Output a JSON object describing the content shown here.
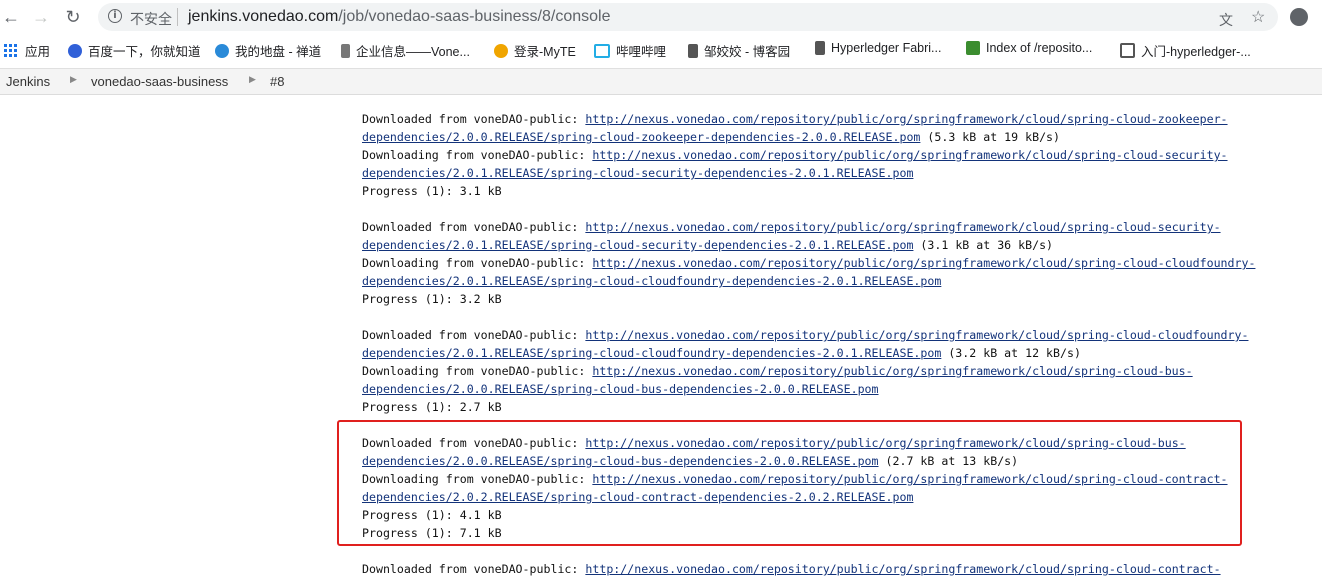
{
  "browser": {
    "security_label": "不安全",
    "url_host": "jenkins.vonedao.com",
    "url_path": "/job/vonedao-saas-business/8/console",
    "bookmarks": [
      {
        "label": "应用",
        "color": "#1a73e8"
      },
      {
        "label": "百度一下，你就知道",
        "color": "#3060d8"
      },
      {
        "label": "我的地盘 - 禅道",
        "color": "#2a8ad8"
      },
      {
        "label": "企业信息——Vone...",
        "color": "#555555"
      },
      {
        "label": "登录-MyTE",
        "color": "#f0a500"
      },
      {
        "label": "哔哩哔哩",
        "color": "#23ade5"
      },
      {
        "label": "邹姣姣 - 博客园",
        "color": "#555555"
      },
      {
        "label": "Hyperledger Fabri...",
        "color": "#555555"
      },
      {
        "label": "Index of /reposito...",
        "color": "#3b8d2f"
      },
      {
        "label": "入门-hyperledger-...",
        "color": "#555555"
      }
    ]
  },
  "jenkins": {
    "breadcrumbs": [
      "Jenkins",
      "vonedao-saas-business",
      "#8"
    ]
  },
  "console": {
    "lines": [
      {
        "prefix": "Downloaded from voneDAO-public: ",
        "link": "http://nexus.vonedao.com/repository/public/org/springframework/cloud/spring-cloud-zookeeper-",
        "suffix": ""
      },
      {
        "prefix": "",
        "link": "dependencies/2.0.0.RELEASE/spring-cloud-zookeeper-dependencies-2.0.0.RELEASE.pom",
        "suffix": " (5.3 kB at 19 kB/s)"
      },
      {
        "prefix": "Downloading from voneDAO-public: ",
        "link": "http://nexus.vonedao.com/repository/public/org/springframework/cloud/spring-cloud-security-",
        "suffix": ""
      },
      {
        "prefix": "",
        "link": "dependencies/2.0.1.RELEASE/spring-cloud-security-dependencies-2.0.1.RELEASE.pom",
        "suffix": ""
      },
      {
        "prefix": "Progress (1): 3.1 kB",
        "link": "",
        "suffix": ""
      },
      {
        "prefix": "",
        "link": "",
        "suffix": ""
      },
      {
        "prefix": "Downloaded from voneDAO-public: ",
        "link": "http://nexus.vonedao.com/repository/public/org/springframework/cloud/spring-cloud-security-",
        "suffix": ""
      },
      {
        "prefix": "",
        "link": "dependencies/2.0.1.RELEASE/spring-cloud-security-dependencies-2.0.1.RELEASE.pom",
        "suffix": " (3.1 kB at 36 kB/s)"
      },
      {
        "prefix": "Downloading from voneDAO-public: ",
        "link": "http://nexus.vonedao.com/repository/public/org/springframework/cloud/spring-cloud-cloudfoundry-",
        "suffix": ""
      },
      {
        "prefix": "",
        "link": "dependencies/2.0.1.RELEASE/spring-cloud-cloudfoundry-dependencies-2.0.1.RELEASE.pom",
        "suffix": ""
      },
      {
        "prefix": "Progress (1): 3.2 kB",
        "link": "",
        "suffix": ""
      },
      {
        "prefix": "",
        "link": "",
        "suffix": ""
      },
      {
        "prefix": "Downloaded from voneDAO-public: ",
        "link": "http://nexus.vonedao.com/repository/public/org/springframework/cloud/spring-cloud-cloudfoundry-",
        "suffix": ""
      },
      {
        "prefix": "",
        "link": "dependencies/2.0.1.RELEASE/spring-cloud-cloudfoundry-dependencies-2.0.1.RELEASE.pom",
        "suffix": " (3.2 kB at 12 kB/s)"
      },
      {
        "prefix": "Downloading from voneDAO-public: ",
        "link": "http://nexus.vonedao.com/repository/public/org/springframework/cloud/spring-cloud-bus-",
        "suffix": ""
      },
      {
        "prefix": "",
        "link": "dependencies/2.0.0.RELEASE/spring-cloud-bus-dependencies-2.0.0.RELEASE.pom",
        "suffix": ""
      },
      {
        "prefix": "Progress (1): 2.7 kB",
        "link": "",
        "suffix": ""
      },
      {
        "prefix": "",
        "link": "",
        "suffix": ""
      },
      {
        "prefix": "Downloaded from voneDAO-public: ",
        "link": "http://nexus.vonedao.com/repository/public/org/springframework/cloud/spring-cloud-bus-",
        "suffix": ""
      },
      {
        "prefix": "",
        "link": "dependencies/2.0.0.RELEASE/spring-cloud-bus-dependencies-2.0.0.RELEASE.pom",
        "suffix": " (2.7 kB at 13 kB/s)"
      },
      {
        "prefix": "Downloading from voneDAO-public: ",
        "link": "http://nexus.vonedao.com/repository/public/org/springframework/cloud/spring-cloud-contract-",
        "suffix": ""
      },
      {
        "prefix": "",
        "link": "dependencies/2.0.2.RELEASE/spring-cloud-contract-dependencies-2.0.2.RELEASE.pom",
        "suffix": ""
      },
      {
        "prefix": "Progress (1): 4.1 kB",
        "link": "",
        "suffix": ""
      },
      {
        "prefix": "Progress (1): 7.1 kB",
        "link": "",
        "suffix": ""
      },
      {
        "prefix": "",
        "link": "",
        "suffix": ""
      },
      {
        "prefix": "Downloaded from voneDAO-public: ",
        "link": "http://nexus.vonedao.com/repository/public/org/springframework/cloud/spring-cloud-contract-",
        "suffix": ""
      }
    ]
  },
  "highlight_color": "#e0201e"
}
